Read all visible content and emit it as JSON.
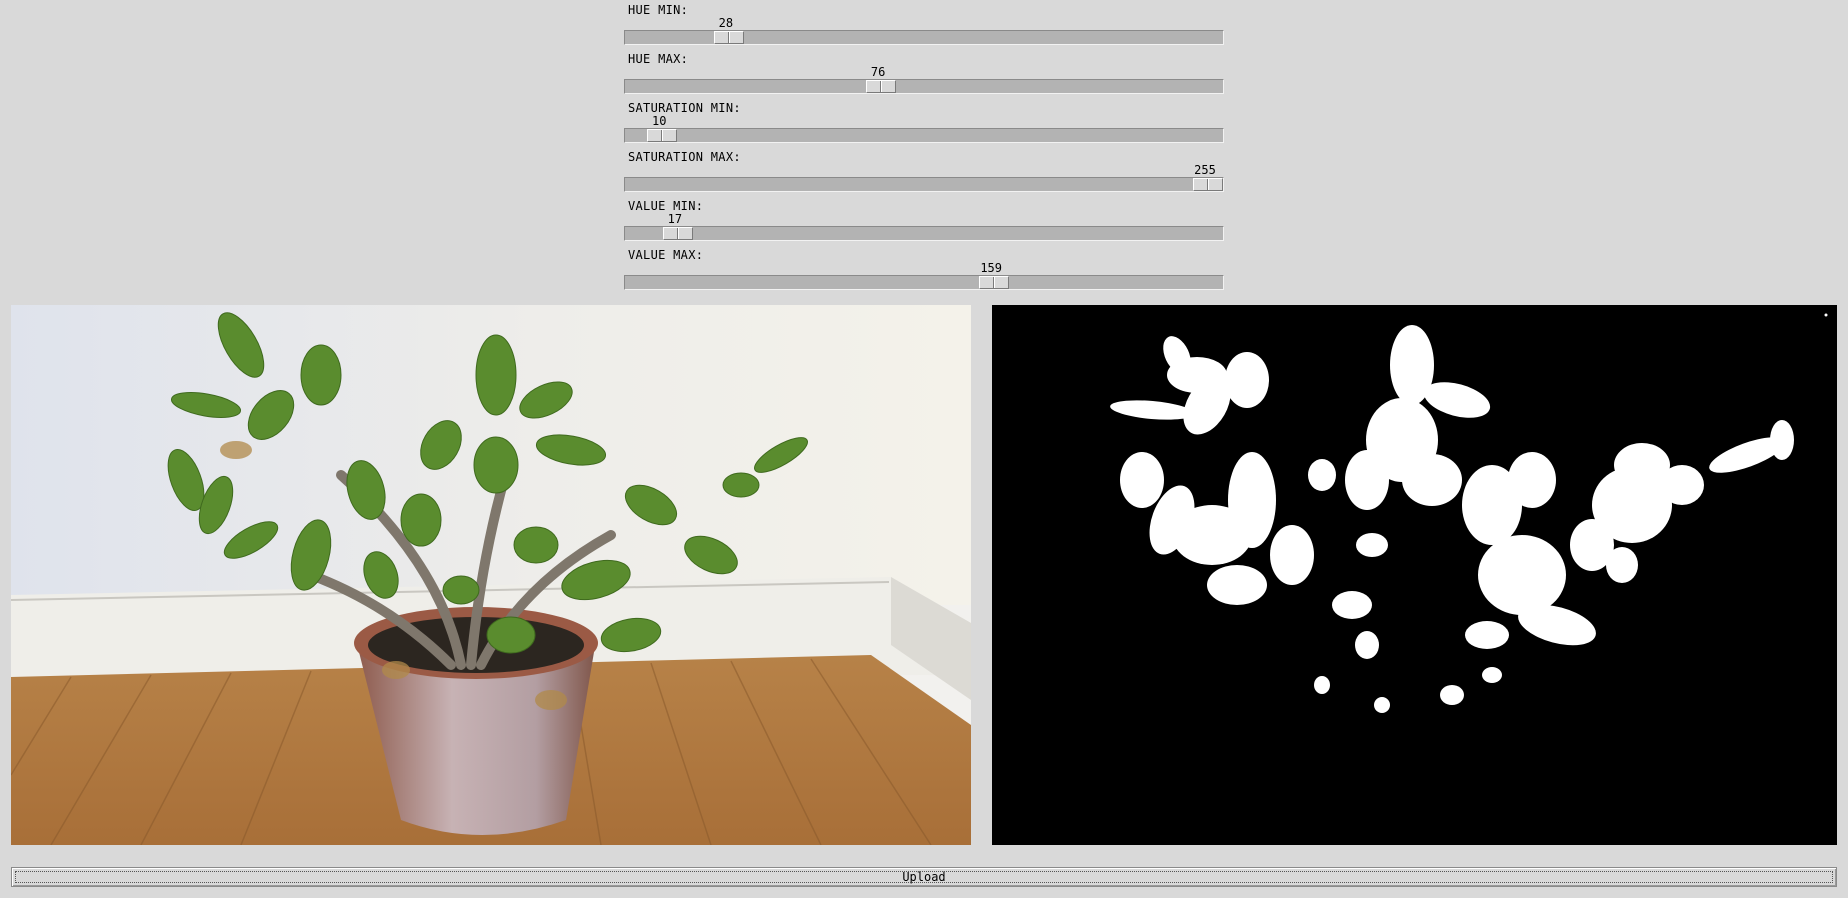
{
  "sliders": [
    {
      "label": "HUE MIN:",
      "value": "28",
      "min": 0,
      "max": 179
    },
    {
      "label": "HUE MAX:",
      "value": "76",
      "min": 0,
      "max": 179
    },
    {
      "label": "SATURATION MIN:",
      "value": "10",
      "min": 0,
      "max": 255
    },
    {
      "label": "SATURATION MAX:",
      "value": "255",
      "min": 0,
      "max": 255
    },
    {
      "label": "VALUE MIN:",
      "value": "17",
      "min": 0,
      "max": 255
    },
    {
      "label": "VALUE MAX:",
      "value": "159",
      "min": 0,
      "max": 255
    }
  ],
  "images": {
    "photo": "jade-plant-photo",
    "mask": "hsv-threshold-mask"
  },
  "upload": {
    "label": "Upload"
  },
  "colors": {
    "window_bg": "#d9d9d9",
    "trough": "#b3b3b3",
    "mask_bg": "#000000",
    "mask_fg": "#ffffff"
  }
}
